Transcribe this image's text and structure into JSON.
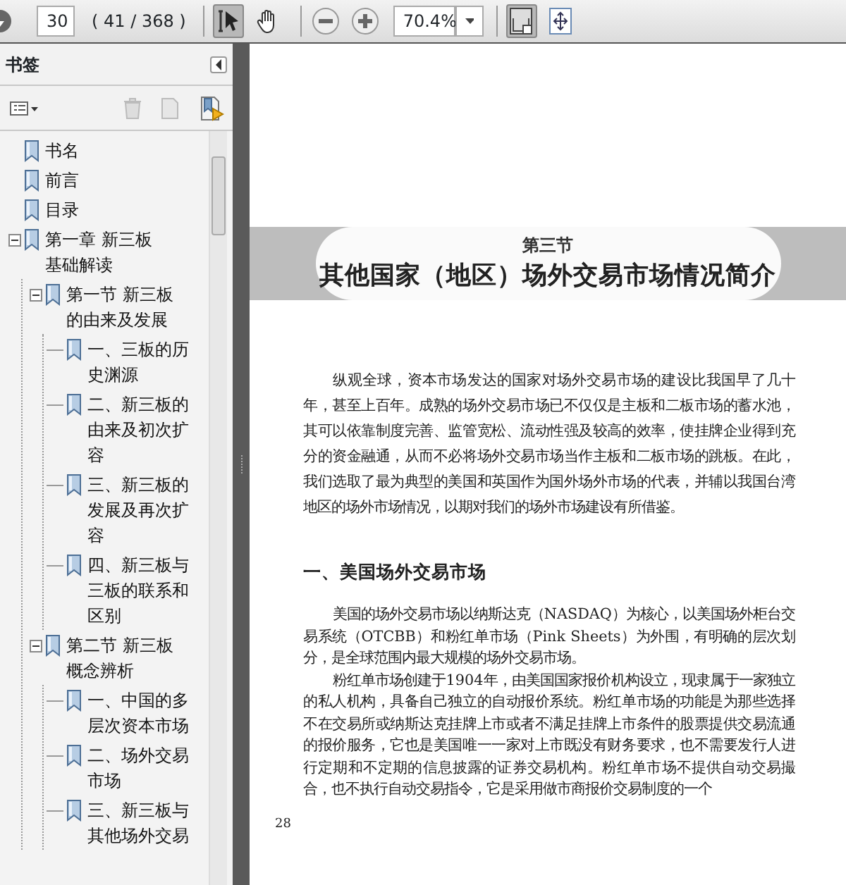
{
  "toolbar": {
    "page_field": "30",
    "page_count": "( 41 / 368 )",
    "tools": [
      {
        "kind": "select",
        "selected": true
      },
      {
        "kind": "hand",
        "selected": false
      }
    ],
    "zoom_field": "70.4%",
    "view_buttons": [
      {
        "kind": "single-page",
        "selected": true
      },
      {
        "kind": "fit-page",
        "selected": false
      }
    ]
  },
  "bookmarks": {
    "title": "书签",
    "items": [
      {
        "label": "书名"
      },
      {
        "label": "前言"
      },
      {
        "label": "目录"
      },
      {
        "label": "第一章 新三板基础解读",
        "expanded": true,
        "children": [
          {
            "label": "第一节 新三板的由来及发展",
            "expanded": true,
            "children": [
              {
                "label": "一、三板的历史渊源"
              },
              {
                "label": "二、新三板的由来及初次扩容"
              },
              {
                "label": "三、新三板的发展及再次扩容"
              },
              {
                "label": "四、新三板与三板的联系和区别"
              }
            ]
          },
          {
            "label": "第二节 新三板概念辨析",
            "expanded": true,
            "children": [
              {
                "label": "一、中国的多层次资本市场"
              },
              {
                "label": "二、场外交易市场"
              },
              {
                "label": "三、新三板与其他场外交易"
              }
            ]
          }
        ]
      }
    ]
  },
  "page": {
    "section_number": "第三节",
    "section_title": "其他国家（地区）场外交易市场情况简介",
    "intro": "纵观全球，资本市场发达的国家对场外交易市场的建设比我国早了几十年，甚至上百年。成熟的场外交易市场已不仅仅是主板和二板市场的蓄水池，其可以依靠制度完善、监管宽松、流动性强及较高的效率，使挂牌企业得到充分的资金融通，从而不必将场外交易市场当作主板和二板市场的跳板。在此，我们选取了最为典型的美国和英国作为国外场外市场的代表，并辅以我国台湾地区的场外市场情况，以期对我们的场外市场建设有所借鉴。",
    "heading": "一、美国场外交易市场",
    "paragraphs": [
      "美国的场外交易市场以纳斯达克（NASDAQ）为核心，以美国场外柜台交易系统（OTCBB）和粉红单市场（Pink Sheets）为外围，有明确的层次划分，是全球范围内最大规模的场外交易市场。",
      "粉红单市场创建于1904年，由美国国家报价机构设立，现隶属于一家独立的私人机构，具备自己独立的自动报价系统。粉红单市场的功能是为那些选择不在交易所或纳斯达克挂牌上市或者不满足挂牌上市条件的股票提供交易流通的报价服务，它也是美国唯一一家对上市既没有财务要求，也不需要发行人进行定期和不定期的信息披露的证券交易机构。粉红单市场不提供自动交易撮合，也不执行自动交易指令，它是采用做市商报价交易制度的一个"
    ],
    "page_number": "28"
  }
}
